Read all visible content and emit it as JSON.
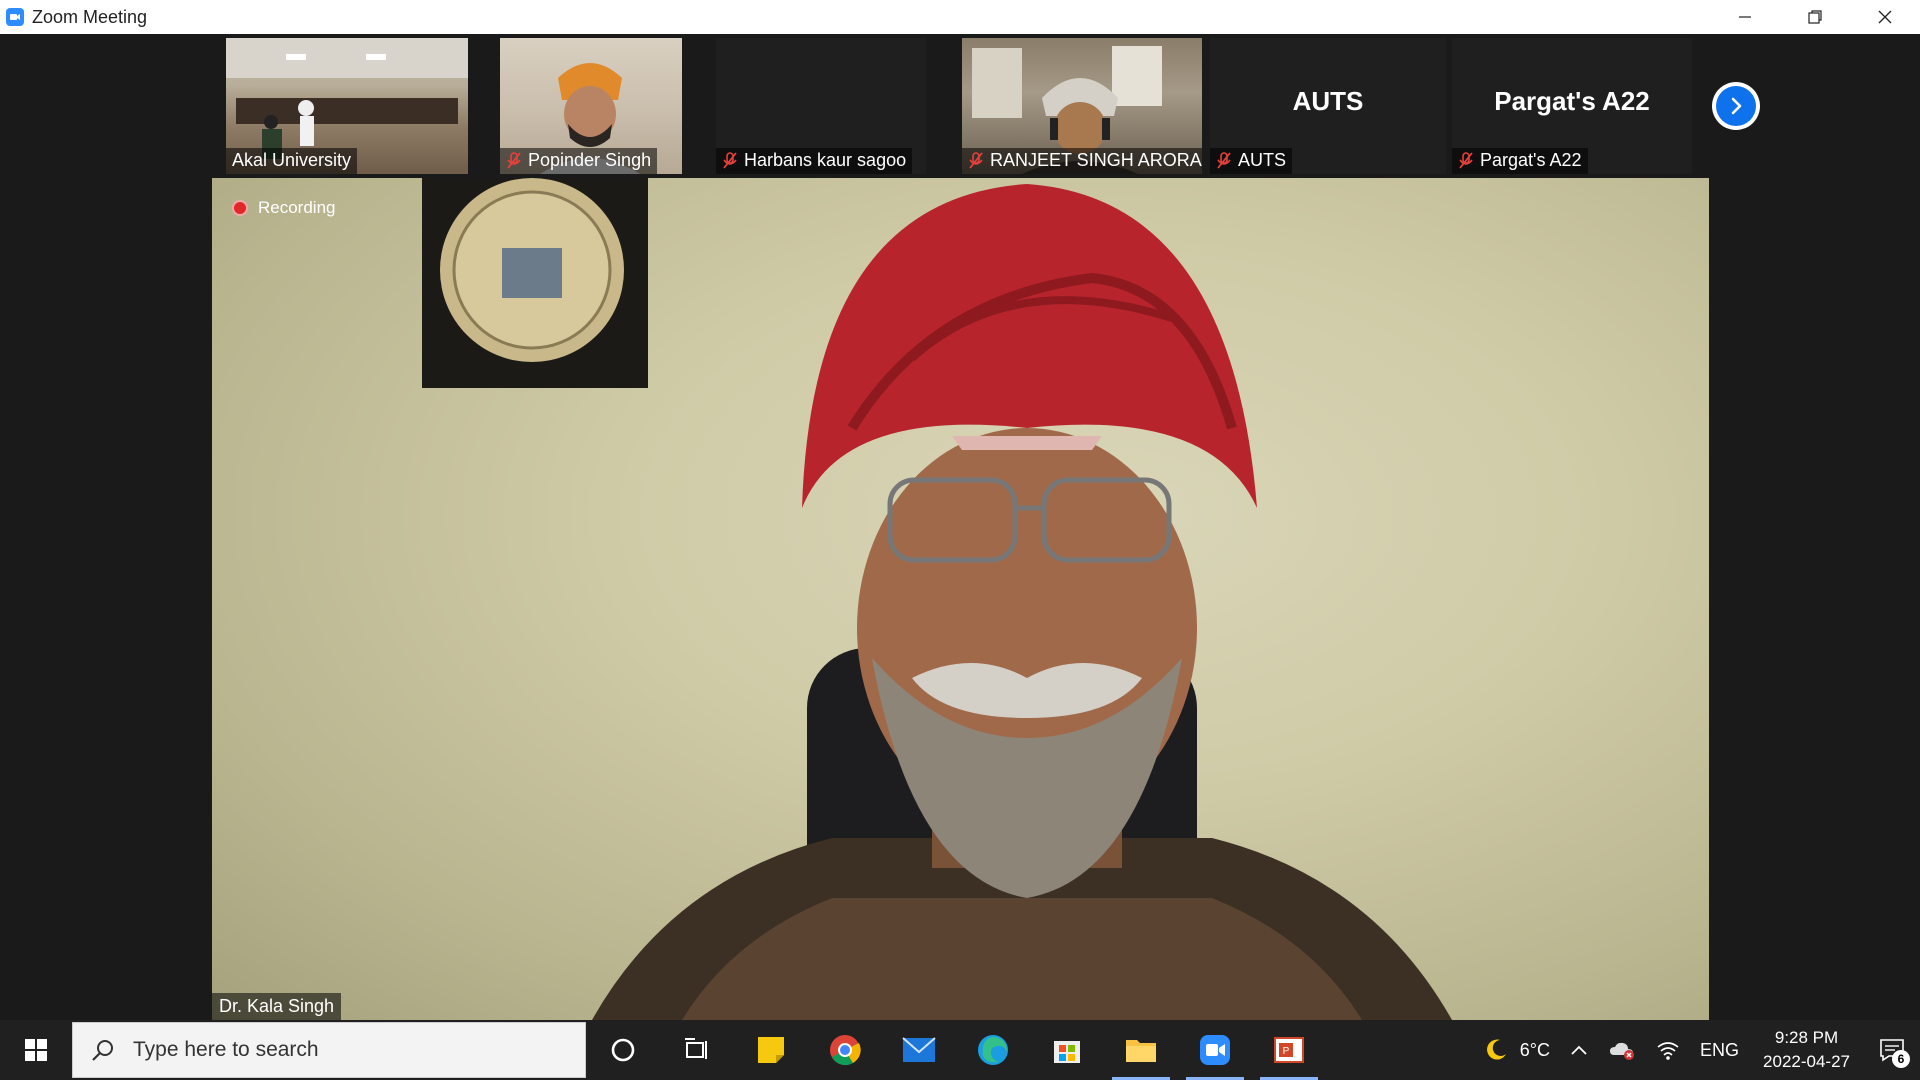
{
  "window": {
    "title": "Zoom Meeting"
  },
  "participants_strip": [
    {
      "name": "Akal University",
      "muted": false,
      "has_video": true
    },
    {
      "name": "Popinder Singh",
      "muted": true,
      "has_video": true
    },
    {
      "name": "Harbans kaur sagoo",
      "muted": true,
      "has_video": false
    },
    {
      "name": "RANJEET SINGH ARORA",
      "muted": true,
      "has_video": true
    },
    {
      "name": "AUTS",
      "muted": true,
      "has_video": false,
      "display_label": "AUTS"
    },
    {
      "name": "Pargat's A22",
      "muted": true,
      "has_video": false,
      "display_label": "Pargat's A22"
    }
  ],
  "main": {
    "recording_label": "Recording",
    "speaker_name": "Dr. Kala Singh"
  },
  "taskbar": {
    "search_placeholder": "Type here to search",
    "weather": "6°C",
    "language": "ENG",
    "time": "9:28 PM",
    "date": "2022-04-27",
    "notification_count": "6"
  },
  "colors": {
    "zoom_blue": "#2d8cff",
    "next_button": "#0e72ed",
    "recording_dot": "#e02828",
    "muted_icon": "#e8413c"
  }
}
